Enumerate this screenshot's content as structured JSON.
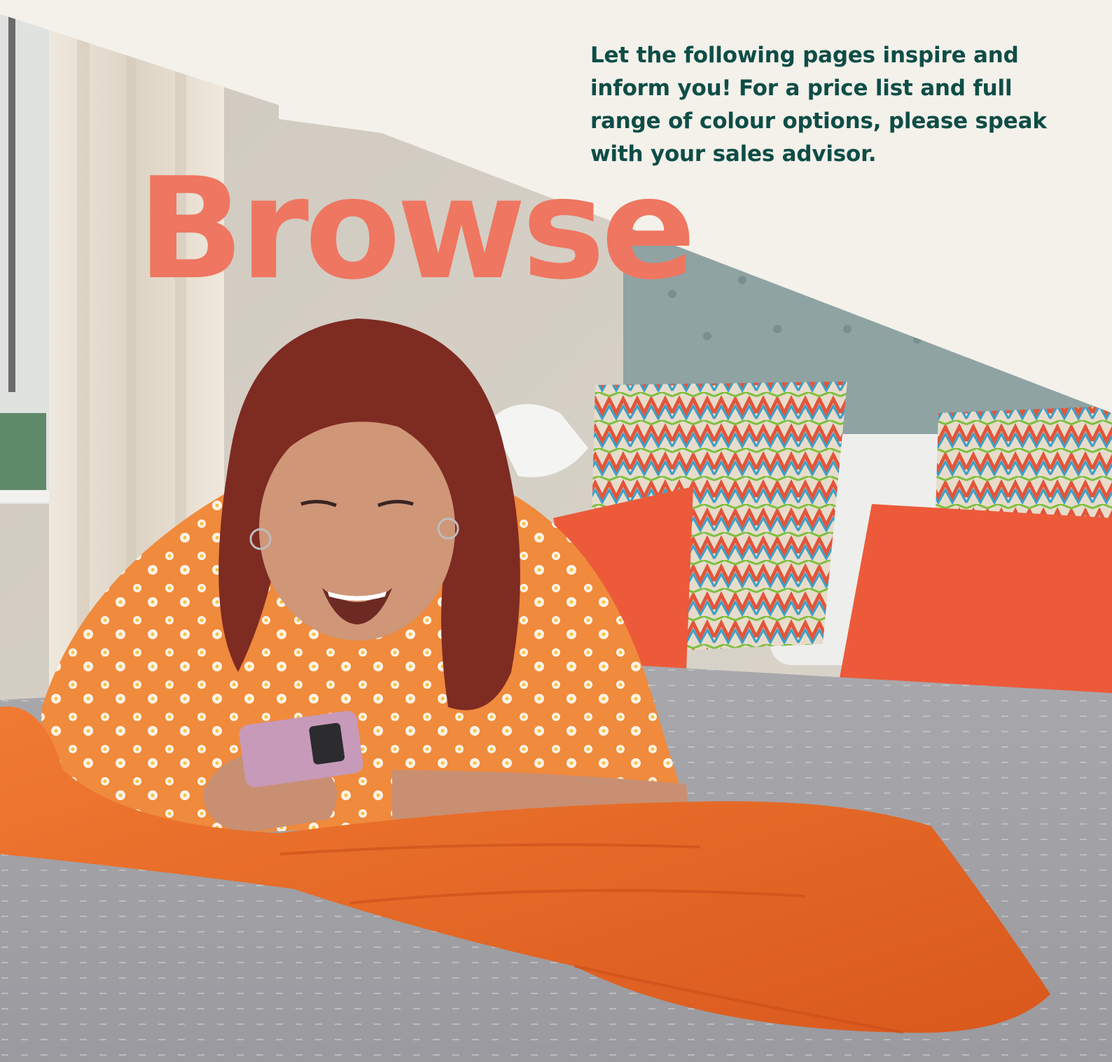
{
  "intro": {
    "text": "Let the following pages inspire and inform you! For a price list and full range of colour options, please speak with your sales advisor."
  },
  "heading": {
    "text": "Browse"
  },
  "colors": {
    "cream": "#f3f1ea",
    "heading": "#ef7660",
    "text": "#0f4d47",
    "wall": "#d9d4ca",
    "curtain": "#e6ded2",
    "headboard": "#8fa3a3",
    "quilt": "#a9a9ad",
    "blanket": "#ea6b2a",
    "cushion": "#ec5a3a",
    "hair": "#7e2b22",
    "skin": "#c98f72",
    "top": "#f08a3c",
    "phone": "#c79ab9"
  },
  "photo": {
    "subject": "woman-lying-on-bed-with-phone"
  }
}
